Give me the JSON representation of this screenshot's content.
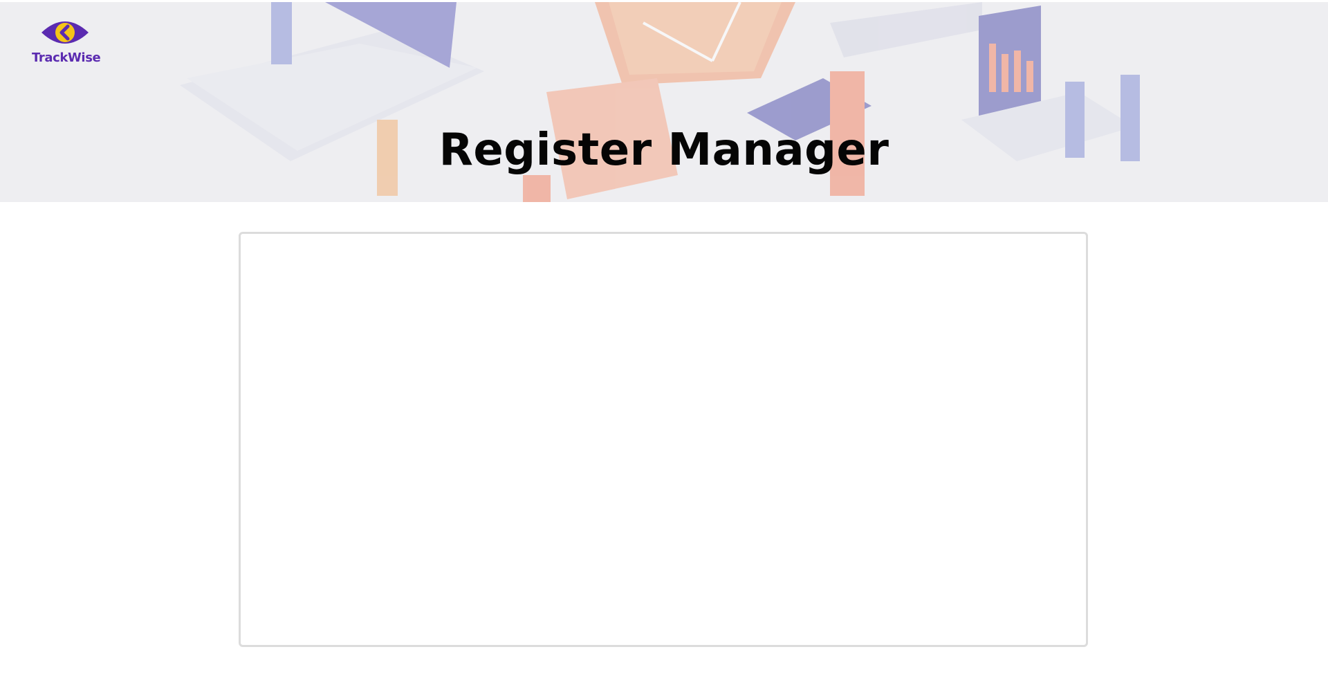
{
  "brand": {
    "name": "TrackWise",
    "logo_icon": "eye-logo-icon",
    "colors": {
      "primary": "#5b2bb0",
      "accent": "#f5c518"
    }
  },
  "header": {
    "title": "Register Manager",
    "background_illustration": "isometric-office-illustration"
  },
  "form": {
    "state": "empty"
  }
}
